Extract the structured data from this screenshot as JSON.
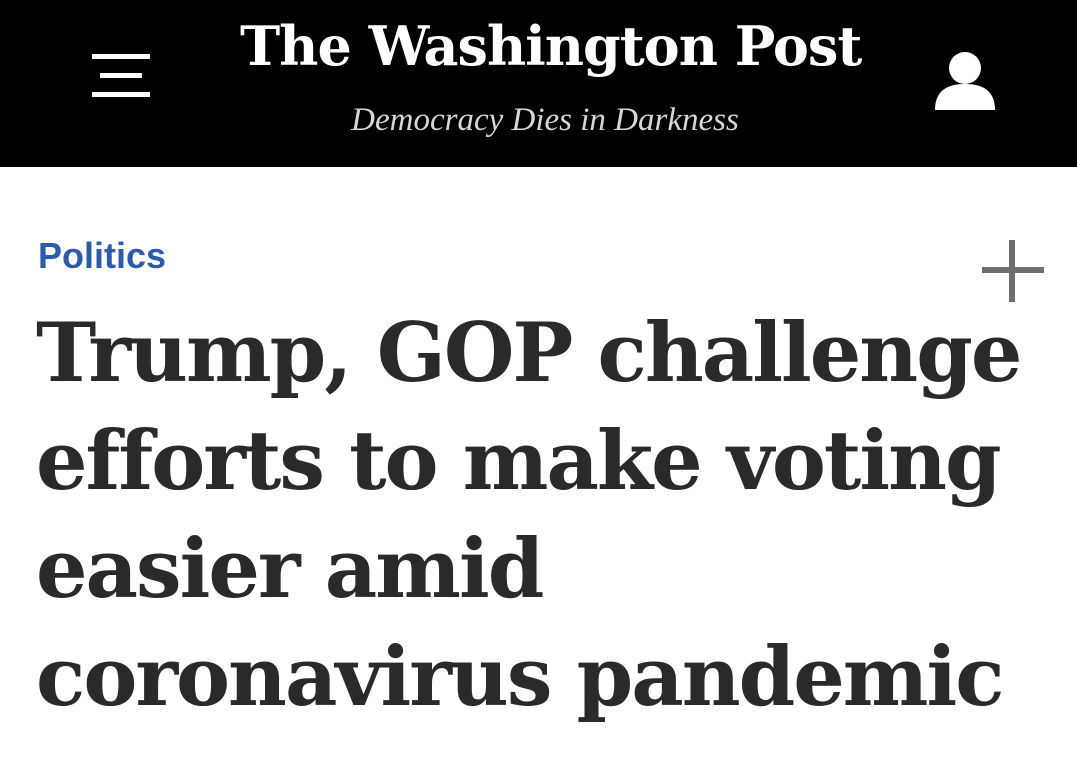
{
  "masthead": {
    "brand": "The Washington Post",
    "tagline": "Democracy Dies in Darkness",
    "menu_icon": "hamburger-menu-icon",
    "account_icon": "user-icon",
    "background_color": "#000000"
  },
  "article": {
    "section": "Politics",
    "section_color": "#2a5caa",
    "add_icon": "plus-icon",
    "headline": "Trump, GOP challenge efforts to make voting easier amid coronavirus pandemic"
  }
}
